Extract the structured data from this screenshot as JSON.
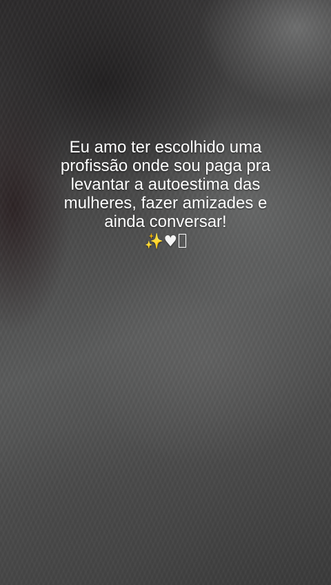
{
  "story": {
    "caption_lines": [
      "Eu amo ter escolhido uma",
      "profissão onde sou paga pra",
      "levantar a autoestima das",
      "mulheres, fazer amizades e",
      "ainda conversar!"
    ],
    "emojis": {
      "sparkles": "✨",
      "heart": "♥",
      "missing_glyph": ""
    },
    "icons": [
      "sparkles-icon",
      "white-heart-icon",
      "missing-glyph-icon"
    ],
    "colors": {
      "text": "#ffffff",
      "background": "#4a4a4a",
      "sparkles": "#ffd43b"
    }
  }
}
